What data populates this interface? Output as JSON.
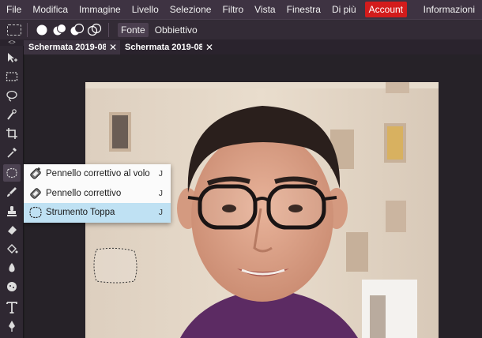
{
  "menubar": {
    "items": [
      "File",
      "Modifica",
      "Immagine",
      "Livello",
      "Selezione",
      "Filtro",
      "Vista",
      "Finestra",
      "Di più"
    ],
    "account": "Account",
    "info": "Informazioni"
  },
  "options": {
    "tab_source": "Fonte",
    "tab_target": "Obbiettivo"
  },
  "toolbar_handle": "<>",
  "doc_tabs": [
    {
      "title": "Schermata 2019-08",
      "close": "✕"
    },
    {
      "title": "Schermata 2019-08",
      "close": "✕"
    }
  ],
  "flyout": {
    "items": [
      {
        "label": "Pennello correttivo al volo",
        "shortcut": "J",
        "icon": "spot-healing-brush-icon"
      },
      {
        "label": "Pennello correttivo",
        "shortcut": "J",
        "icon": "healing-brush-icon"
      },
      {
        "label": "Strumento Toppa",
        "shortcut": "J",
        "icon": "patch-tool-icon",
        "selected": true
      }
    ]
  },
  "colors": {
    "menubar_bg": "#3e3342",
    "account_bg": "#d31c1c",
    "flyout_selected": "#bfe1f3"
  }
}
